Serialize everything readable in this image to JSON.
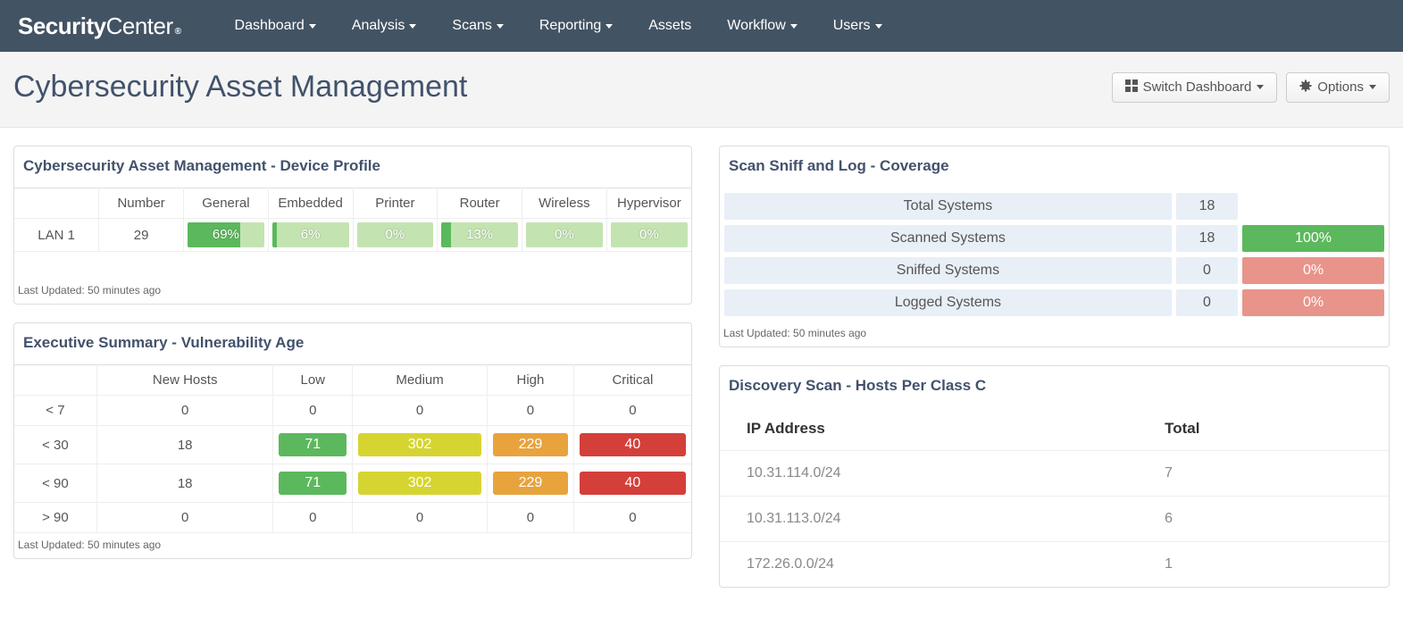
{
  "brand": {
    "part1": "Security",
    "part2": "Center",
    "tm": "®"
  },
  "nav": [
    "Dashboard",
    "Analysis",
    "Scans",
    "Reporting",
    "Assets",
    "Workflow",
    "Users"
  ],
  "nav_has_caret": [
    true,
    true,
    true,
    true,
    false,
    true,
    true
  ],
  "page_title": "Cybersecurity Asset Management",
  "buttons": {
    "switch": "Switch Dashboard",
    "options": "Options"
  },
  "updated_text": "Last Updated: 50 minutes ago",
  "device_profile": {
    "title": "Cybersecurity Asset Management - Device Profile",
    "headers": [
      "",
      "Number",
      "General",
      "Embedded",
      "Printer",
      "Router",
      "Wireless",
      "Hypervisor"
    ],
    "row_label": "LAN 1",
    "number": "29",
    "bars": [
      {
        "label": "69%",
        "pct": 69
      },
      {
        "label": "6%",
        "pct": 6
      },
      {
        "label": "0%",
        "pct": 0
      },
      {
        "label": "13%",
        "pct": 13
      },
      {
        "label": "0%",
        "pct": 0
      },
      {
        "label": "0%",
        "pct": 0
      }
    ]
  },
  "vuln_age": {
    "title": "Executive Summary - Vulnerability Age",
    "headers": [
      "",
      "New Hosts",
      "Low",
      "Medium",
      "High",
      "Critical"
    ],
    "rows": [
      {
        "label": "< 7",
        "hosts": "0",
        "low": "0",
        "med": "0",
        "high": "0",
        "crit": "0",
        "colored": false
      },
      {
        "label": "< 30",
        "hosts": "18",
        "low": "71",
        "med": "302",
        "high": "229",
        "crit": "40",
        "colored": true
      },
      {
        "label": "< 90",
        "hosts": "18",
        "low": "71",
        "med": "302",
        "high": "229",
        "crit": "40",
        "colored": true
      },
      {
        "label": "> 90",
        "hosts": "0",
        "low": "0",
        "med": "0",
        "high": "0",
        "crit": "0",
        "colored": false
      }
    ]
  },
  "coverage": {
    "title": "Scan Sniff and Log - Coverage",
    "rows": [
      {
        "label": "Total Systems",
        "count": "18",
        "pct": "",
        "cls": "blank"
      },
      {
        "label": "Scanned Systems",
        "count": "18",
        "pct": "100%",
        "cls": "green"
      },
      {
        "label": "Sniffed Systems",
        "count": "0",
        "pct": "0%",
        "cls": "red"
      },
      {
        "label": "Logged Systems",
        "count": "0",
        "pct": "0%",
        "cls": "red"
      }
    ]
  },
  "discovery": {
    "title": "Discovery Scan - Hosts Per Class C",
    "headers": [
      "IP Address",
      "Total"
    ],
    "rows": [
      {
        "ip": "10.31.114.0/24",
        "total": "7"
      },
      {
        "ip": "10.31.113.0/24",
        "total": "6"
      },
      {
        "ip": "172.26.0.0/24",
        "total": "1"
      }
    ]
  }
}
